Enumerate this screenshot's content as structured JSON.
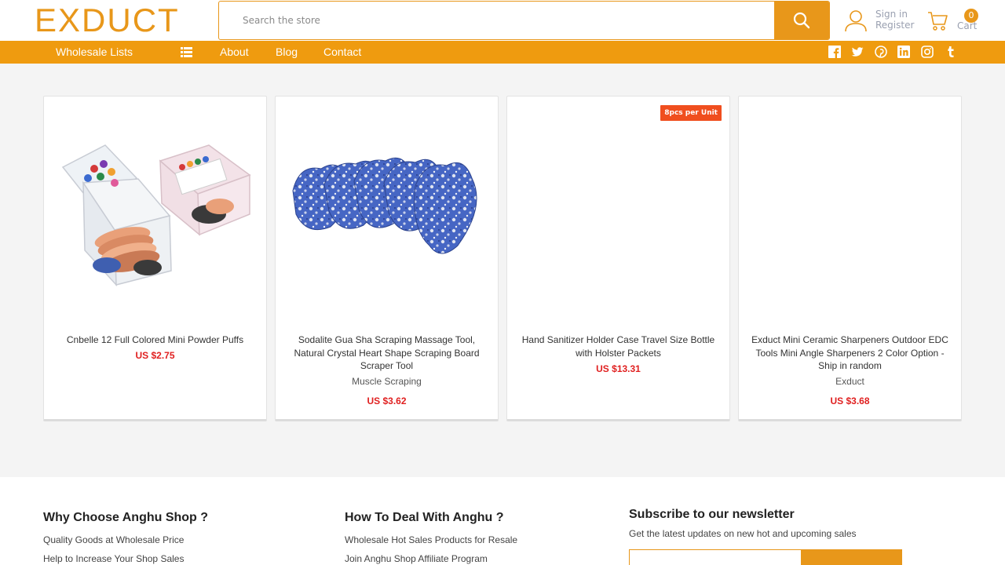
{
  "header": {
    "logo_text": "EXDUCT",
    "search": {
      "placeholder": "Search the store",
      "value": ""
    },
    "account": {
      "sign_in": "Sign in",
      "register": "Register"
    },
    "cart": {
      "count": "0",
      "label": "Cart"
    }
  },
  "nav": {
    "items": [
      "Wholesale Lists",
      "About",
      "Blog",
      "Contact"
    ],
    "social_icons": [
      "facebook-icon",
      "twitter-icon",
      "pinterest-icon",
      "linkedin-icon",
      "instagram-icon",
      "tumblr-icon"
    ]
  },
  "products": [
    {
      "title": "Cnbelle 12 Full Colored Mini Powder Puffs",
      "brand": "",
      "price": "US $2.75",
      "badge": ""
    },
    {
      "title": "Sodalite Gua Sha Scraping Massage Tool, Natural Crystal Heart Shape Scraping Board Scraper Tool",
      "brand": "Muscle Scraping",
      "price": "US $3.62",
      "badge": ""
    },
    {
      "title": "Hand Sanitizer Holder Case Travel Size Bottle with Holster Packets",
      "brand": "",
      "price": "US $13.31",
      "badge": "8pcs per Unit"
    },
    {
      "title": "Exduct Mini Ceramic Sharpeners Outdoor EDC Tools Mini Angle Sharpeners 2 Color Option - Ship in random",
      "brand": "Exduct",
      "price": "US $3.68",
      "badge": ""
    }
  ],
  "footer": {
    "col1": {
      "heading": "Why Choose Anghu Shop ?",
      "links": [
        "Quality Goods at Wholesale Price",
        "Help to Increase Your Shop Sales"
      ]
    },
    "col2": {
      "heading": "How To Deal With Anghu ?",
      "links": [
        "Wholesale Hot Sales Products for Resale",
        "Join Anghu Shop Affiliate Program"
      ]
    },
    "newsletter": {
      "heading": "Subscribe to our newsletter",
      "text": "Get the latest updates on new hot and upcoming sales"
    }
  },
  "colors": {
    "brand_orange": "#e8971a",
    "nav_orange": "#ef9b0f",
    "price_red": "#e02020",
    "badge_red": "#f04e1e"
  }
}
